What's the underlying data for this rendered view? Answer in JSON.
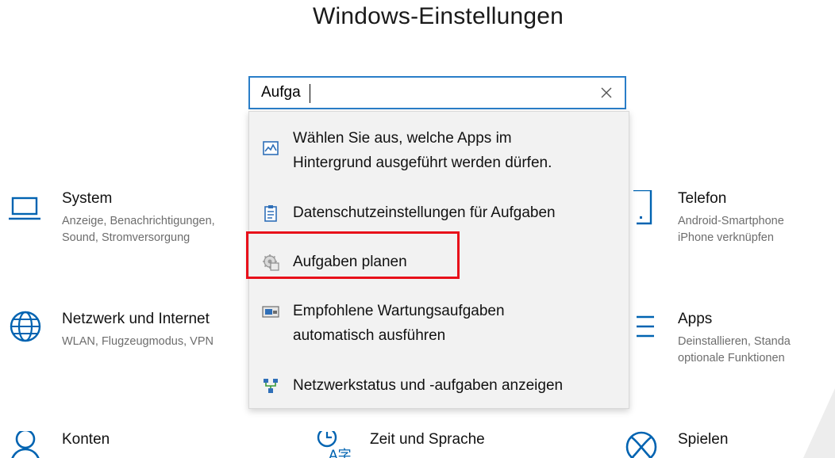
{
  "window": {
    "title": "Windows-Einstellungen"
  },
  "search": {
    "value": "Aufga",
    "placeholder": ""
  },
  "results": [
    {
      "line1": "Wählen Sie aus, welche Apps im",
      "line2": "Hintergrund ausgeführt werden dürfen.",
      "icon": "background-apps-icon"
    },
    {
      "line1": "Datenschutzeinstellungen für Aufgaben",
      "icon": "clipboard-icon"
    },
    {
      "line1": "Aufgaben planen",
      "icon": "task-scheduler-icon",
      "highlighted": true
    },
    {
      "line1": "Empfohlene Wartungsaufgaben",
      "line2": "automatisch ausführen",
      "icon": "maintenance-icon"
    },
    {
      "line1": "Netzwerkstatus und -aufgaben anzeigen",
      "icon": "network-status-icon"
    }
  ],
  "tiles": {
    "system": {
      "name": "System",
      "desc1": "Anzeige, Benachrichtigungen,",
      "desc2": "Sound, Stromversorgung",
      "icon": "laptop-icon"
    },
    "telefon": {
      "name": "Telefon",
      "desc1": "Android-Smartphone",
      "desc2": "iPhone verknüpfen",
      "icon": "phone-icon"
    },
    "netzwerk": {
      "name": "Netzwerk und Internet",
      "desc1": "WLAN, Flugzeugmodus, VPN",
      "icon": "globe-icon"
    },
    "apps": {
      "name": "Apps",
      "desc1": "Deinstallieren, Standa",
      "desc2": "optionale Funktionen",
      "icon": "apps-list-icon"
    },
    "konten": {
      "name": "Konten",
      "icon": "person-icon"
    },
    "zeit": {
      "name": "Zeit und Sprache",
      "icon": "time-language-icon"
    },
    "spielen": {
      "name": "Spielen",
      "icon": "xbox-icon"
    }
  },
  "colors": {
    "accent": "#0063b1",
    "search_border": "#2a7ec8",
    "highlight": "#e8101a"
  }
}
